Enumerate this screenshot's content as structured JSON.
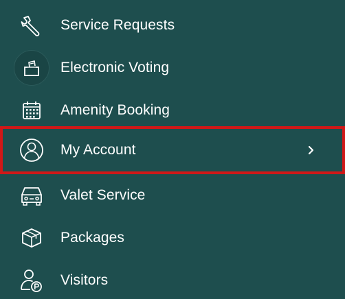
{
  "menu": {
    "items": [
      {
        "label": "Service Requests",
        "icon": "wrench-icon"
      },
      {
        "label": "Electronic Voting",
        "icon": "ballot-box-icon"
      },
      {
        "label": "Amenity Booking",
        "icon": "calendar-icon"
      },
      {
        "label": "My Account",
        "icon": "user-circle-icon",
        "selected": true
      },
      {
        "label": "Valet Service",
        "icon": "car-icon"
      },
      {
        "label": "Packages",
        "icon": "package-icon"
      },
      {
        "label": "Visitors",
        "icon": "visitor-icon"
      }
    ]
  },
  "colors": {
    "background": "#1e4e4e",
    "text": "#ffffff",
    "highlight_border": "#d01818"
  }
}
